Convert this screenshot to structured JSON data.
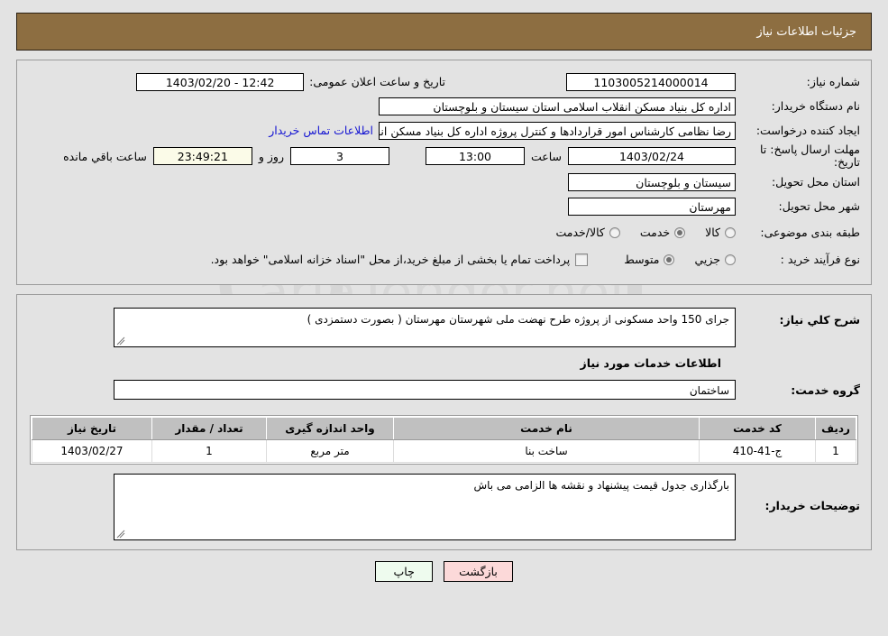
{
  "header": {
    "title": "جزئیات اطلاعات نیاز"
  },
  "form": {
    "need_number_label": "شماره نیاز:",
    "need_number_value": "1103005214000014",
    "announce_label": "تاریخ و ساعت اعلان عمومی:",
    "announce_value": "12:42 - 1403/02/20",
    "buyer_org_label": "نام دستگاه خریدار:",
    "buyer_org_value": "اداره کل بنیاد مسکن انقلاب اسلامی استان سیستان و بلوچستان",
    "creator_label": "ایجاد کننده درخواست:",
    "creator_value": "رضا نظامی کارشناس امور قراردادها و کنترل پروژه اداره کل بنیاد مسکن انقلاب اسلامی",
    "contact_link": "اطلاعات تماس خریدار",
    "deadline_label": "مهلت ارسال پاسخ: تا تاریخ:",
    "deadline_date": "1403/02/24",
    "deadline_hour_label": "ساعت",
    "deadline_hour": "13:00",
    "days_value": "3",
    "days_label": "روز و",
    "countdown_value": "23:49:21",
    "countdown_label": "ساعت باقي مانده",
    "province_label": "استان محل تحویل:",
    "province_value": "سیستان و بلوچستان",
    "city_label": "شهر محل تحویل:",
    "city_value": "مهرستان",
    "category_label": "طبقه بندی موضوعی:",
    "category_options": [
      {
        "label": "کالا",
        "selected": false
      },
      {
        "label": "خدمت",
        "selected": true
      },
      {
        "label": "کالا/خدمت",
        "selected": false
      }
    ],
    "process_label": "نوع فرآیند خرید :",
    "process_options": [
      {
        "label": "جزیي",
        "selected": false
      },
      {
        "label": "متوسط",
        "selected": true
      }
    ],
    "payment_checkbox_label": "پرداخت تمام یا بخشی از مبلغ خرید،از محل \"اسناد خزانه اسلامی\" خواهد بود.",
    "payment_checked": false
  },
  "details": {
    "desc_label": "شرح کلي نیاز:",
    "desc_value": "جرای 150 واحد مسکونی از پروژه طرح نهضت ملی شهرستان مهرستان ( بصورت دستمزدی )",
    "services_section_title": "اطلاعات خدمات مورد نیاز",
    "service_group_label": "گروه خدمت:",
    "service_group_value": "ساختمان"
  },
  "table": {
    "columns": [
      "ردیف",
      "کد خدمت",
      "نام خدمت",
      "واحد اندازه گیری",
      "تعداد / مقدار",
      "تاریخ نیاز"
    ],
    "rows": [
      {
        "row": "1",
        "code": "ج-41-410",
        "name": "ساخت بنا",
        "unit": "متر مربع",
        "qty": "1",
        "date": "1403/02/27"
      }
    ]
  },
  "notes": {
    "label": "توضیحات خریدار:",
    "value": "بارگذاری جدول قیمت پیشنهاد و نقشه ها الزامی می باش"
  },
  "buttons": {
    "print": "چاپ",
    "back": "بازگشت"
  },
  "watermark": {
    "text": "AriaTender.net"
  },
  "colors": {
    "header_brown": "#8d6e41",
    "page_bg": "#e3e3e3",
    "link_blue": "#1414d2",
    "table_header": "#c0c0c0",
    "btn_print": "#eefbee",
    "btn_back": "#fcd9d9",
    "countdown_bg": "#fbfbe8"
  }
}
